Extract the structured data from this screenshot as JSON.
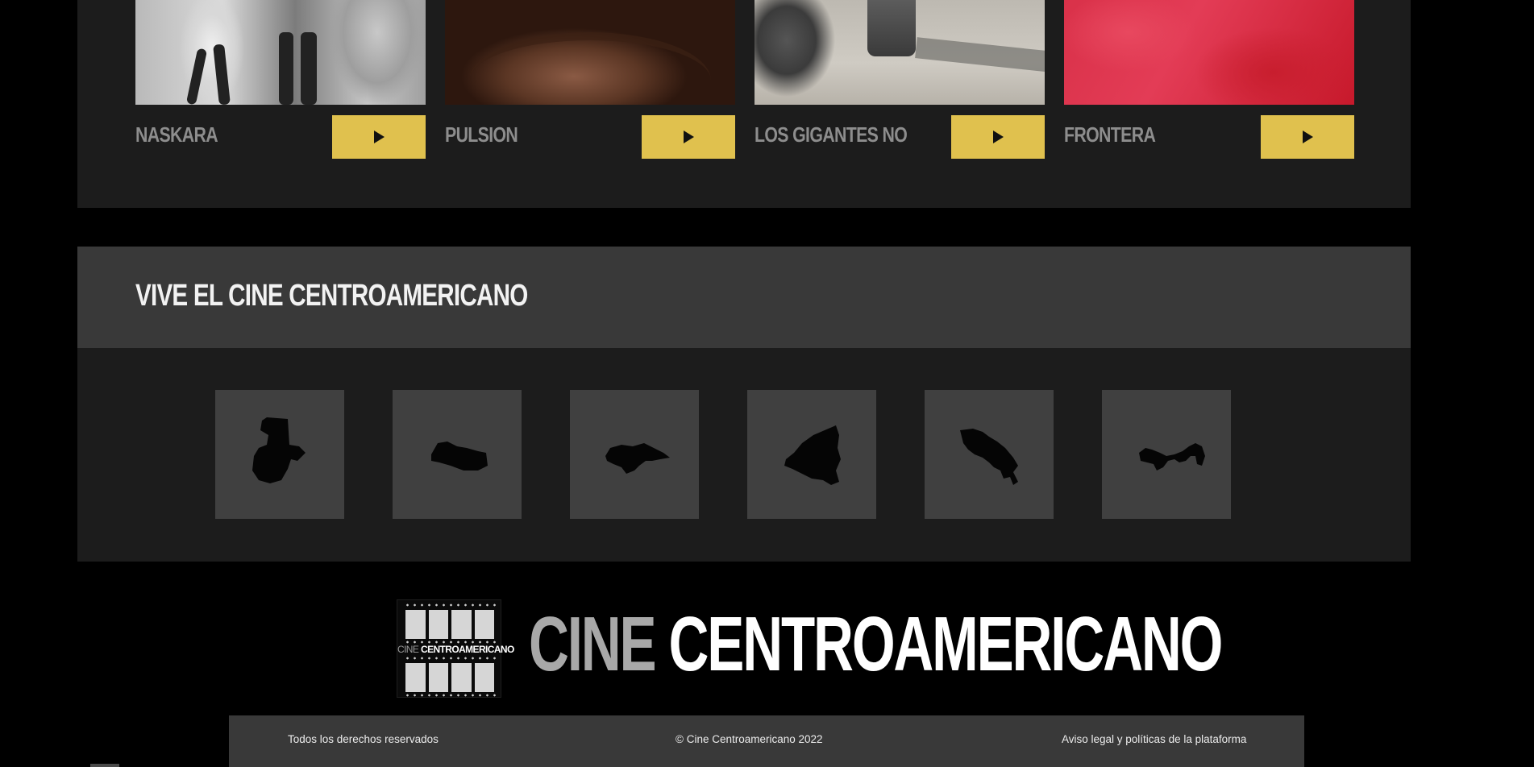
{
  "films": [
    {
      "title": "NASKARA",
      "play_label": "▶"
    },
    {
      "title": "PULSION",
      "play_label": "▶"
    },
    {
      "title": "LOS GIGANTES NO",
      "play_label": "▶"
    },
    {
      "title": "FRONTERA",
      "play_label": "▶"
    }
  ],
  "vive": {
    "title": "VIVE EL CINE CENTROAMERICANO",
    "countries": [
      "guatemala",
      "el-salvador",
      "honduras",
      "nicaragua",
      "costa-rica",
      "panama"
    ]
  },
  "footer": {
    "logo_small_part1": "CINE ",
    "logo_small_part2": "CENTROAMERICANO",
    "wordmark_part1": "CINE ",
    "wordmark_part2": "CENTROAMERICANO",
    "rights": "Todos los derechos reservados",
    "copyright": "© Cine Centroamericano 2022",
    "legal": "Aviso legal y políticas de la plataforma"
  },
  "colors": {
    "accent": "#e0c14e",
    "panel_dark": "#1c1c1c",
    "panel_mid": "#393939",
    "tile": "#404040"
  }
}
